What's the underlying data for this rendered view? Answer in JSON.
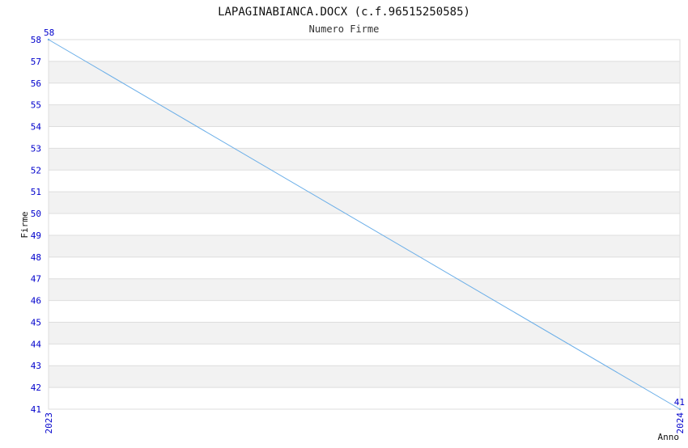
{
  "chart_data": {
    "type": "line",
    "title": "LAPAGINABIANCA.DOCX (c.f.96515250585)",
    "subtitle": "Numero Firme",
    "xlabel": "Anno",
    "ylabel": "Firme",
    "x": [
      "2023",
      "2024"
    ],
    "series": [
      {
        "values": [
          58,
          41
        ]
      }
    ],
    "point_labels": [
      "58",
      "41"
    ],
    "ylim": [
      41,
      58
    ],
    "yticks": [
      "41",
      "42",
      "43",
      "44",
      "45",
      "46",
      "47",
      "48",
      "49",
      "50",
      "51",
      "52",
      "53",
      "54",
      "55",
      "56",
      "57",
      "58"
    ],
    "grid": true,
    "legend": "none",
    "colors": {
      "line": "#6aaee8",
      "tick_text": "#0000cc",
      "title_text": "#111111",
      "band": "#f2f2f2",
      "grid": "#dddddd",
      "axis": "#cccccc"
    }
  }
}
